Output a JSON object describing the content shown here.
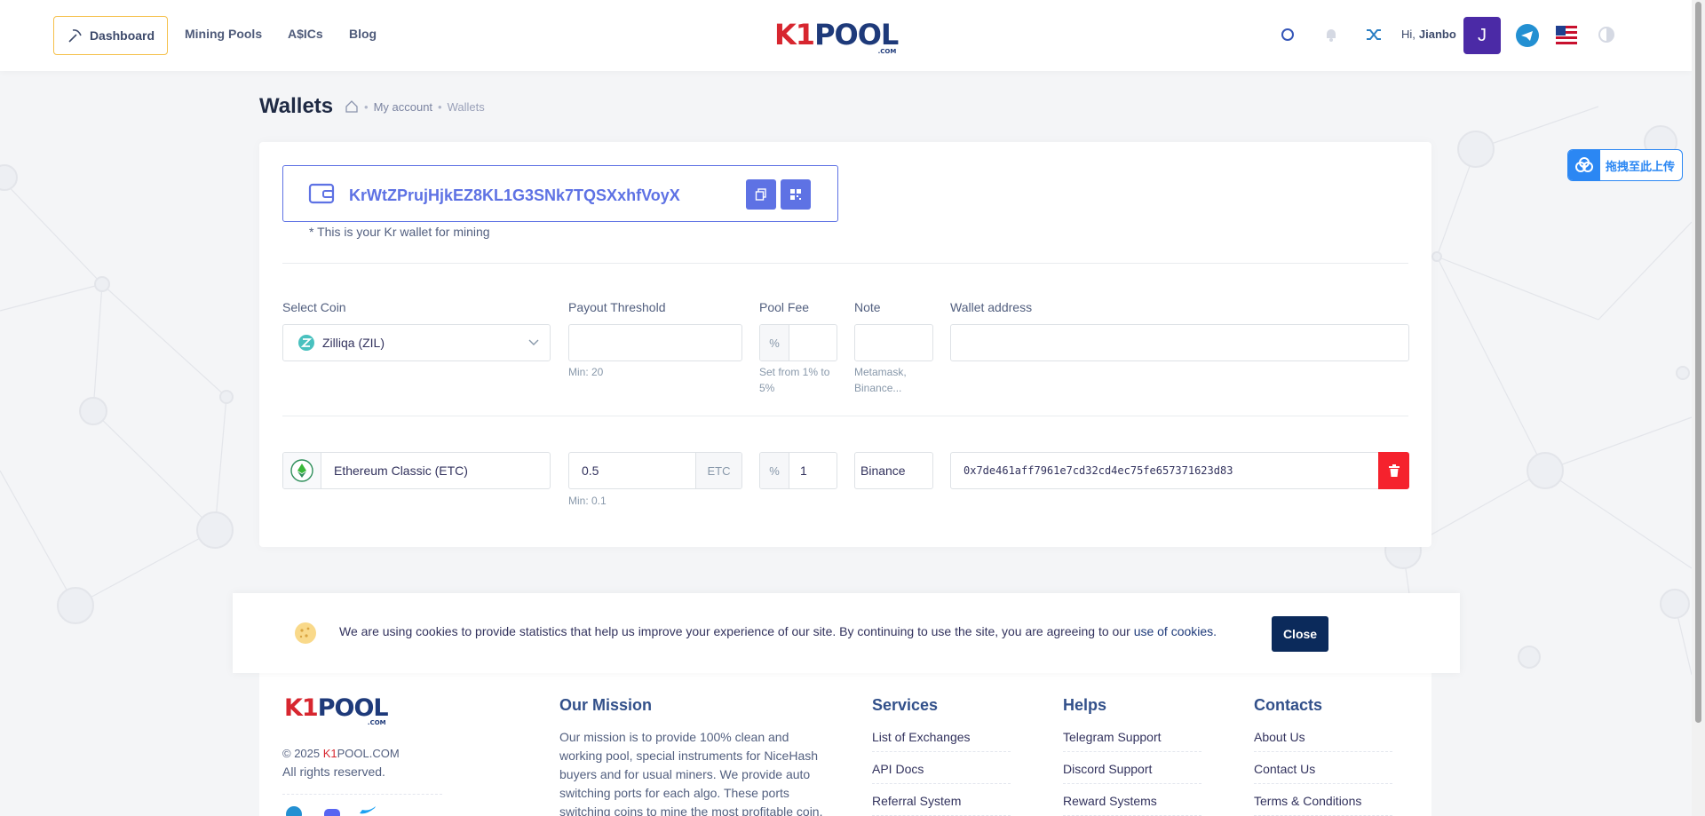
{
  "nav": {
    "dashboard": "Dashboard",
    "mining_pools": "Mining Pools",
    "asics": "A$ICs",
    "blog": "Blog"
  },
  "logo": {
    "k1": "K1",
    "pool": "POOL",
    "com": ".COM"
  },
  "user": {
    "greeting": "Hi,",
    "name": "Jianbo",
    "initial": "J"
  },
  "page": {
    "title": "Wallets"
  },
  "breadcrumb": {
    "parent": "My account",
    "current": "Wallets"
  },
  "wallet": {
    "address": "KrWtZPrujHjkEZ8KL1G3SNk7TQSXxhfVoyX",
    "note": "* This is your Kr wallet for mining"
  },
  "form": {
    "labels": {
      "coin": "Select Coin",
      "threshold": "Payout Threshold",
      "fee": "Pool Fee",
      "note": "Note",
      "address": "Wallet address"
    },
    "new": {
      "coin": "Zilliqa (ZIL)",
      "threshold_hint": "Min: 20",
      "fee_prefix": "%",
      "fee_hint_1": "Set from 1% to",
      "fee_hint_2": "5%",
      "note_hint_1": "Metamask,",
      "note_hint_2": "Binance..."
    },
    "row": {
      "coin": "Ethereum Classic (ETC)",
      "threshold": "0.5",
      "unit": "ETC",
      "threshold_hint": "Min: 0.1",
      "fee_prefix": "%",
      "fee": "1",
      "note": "Binance",
      "address": "0x7de461aff7961e7cd32cd4ec75fe657371623d83"
    }
  },
  "cookie": {
    "text": "We are using cookies to provide statistics that help us improve your experience of our site. By continuing to use the site, you are agreeing to our ",
    "link": "use of cookies.",
    "close": "Close"
  },
  "footer": {
    "copyright_prefix": "© 2025 ",
    "copyright_k1": "K1",
    "copyright_rest": "POOL.COM",
    "rights": "All rights reserved.",
    "mission_title": "Our Mission",
    "mission_text": "Our mission is to provide 100% clean and working pool, special instruments for NiceHash buyers and for usual miners. We provide auto switching ports for each algo. These ports switching coins to mine the most profitable coin.",
    "services_title": "Services",
    "services": [
      "List of Exchanges",
      "API Docs",
      "Referral System"
    ],
    "helps_title": "Helps",
    "helps": [
      "Telegram Support",
      "Discord Support",
      "Reward Systems"
    ],
    "contacts_title": "Contacts",
    "contacts": [
      "About Us",
      "Contact Us",
      "Terms & Conditions"
    ]
  },
  "upload": {
    "label": "拖拽至此上传"
  },
  "colors": {
    "accent": "#5e72e4",
    "brand_red": "#d7262f",
    "brand_blue": "#1e3a7a",
    "danger": "#f5222d"
  }
}
